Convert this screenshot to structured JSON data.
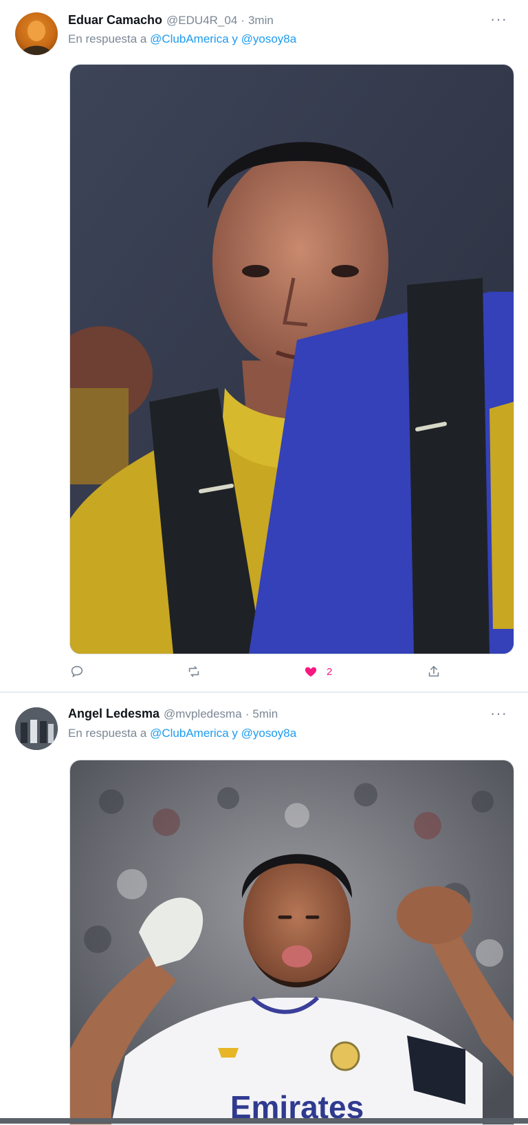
{
  "tweets": [
    {
      "author_name": "Eduar Camacho",
      "handle": "@EDU4R_04",
      "separator": "·",
      "time": "3min",
      "reply_prefix": "En respuesta a",
      "reply_to_1": "@ClubAmerica",
      "reply_join": "y",
      "reply_to_2": "@yosoy8a",
      "more_label": "···",
      "likes": "2",
      "liked": true
    },
    {
      "author_name": "Angel Ledesma",
      "handle": "@mvpledesma",
      "separator": "·",
      "time": "5min",
      "reply_prefix": "En respuesta a",
      "reply_to_1": "@ClubAmerica",
      "reply_join": "y",
      "reply_to_2": "@yosoy8a",
      "more_label": "···",
      "jersey_text": "Emirates"
    }
  ],
  "icons": {
    "reply": "reply-icon",
    "retweet": "retweet-icon",
    "like": "heart-icon",
    "share": "share-icon"
  },
  "colors": {
    "link": "#1d9bf0",
    "like": "#f91880",
    "muted": "#7b8794"
  }
}
